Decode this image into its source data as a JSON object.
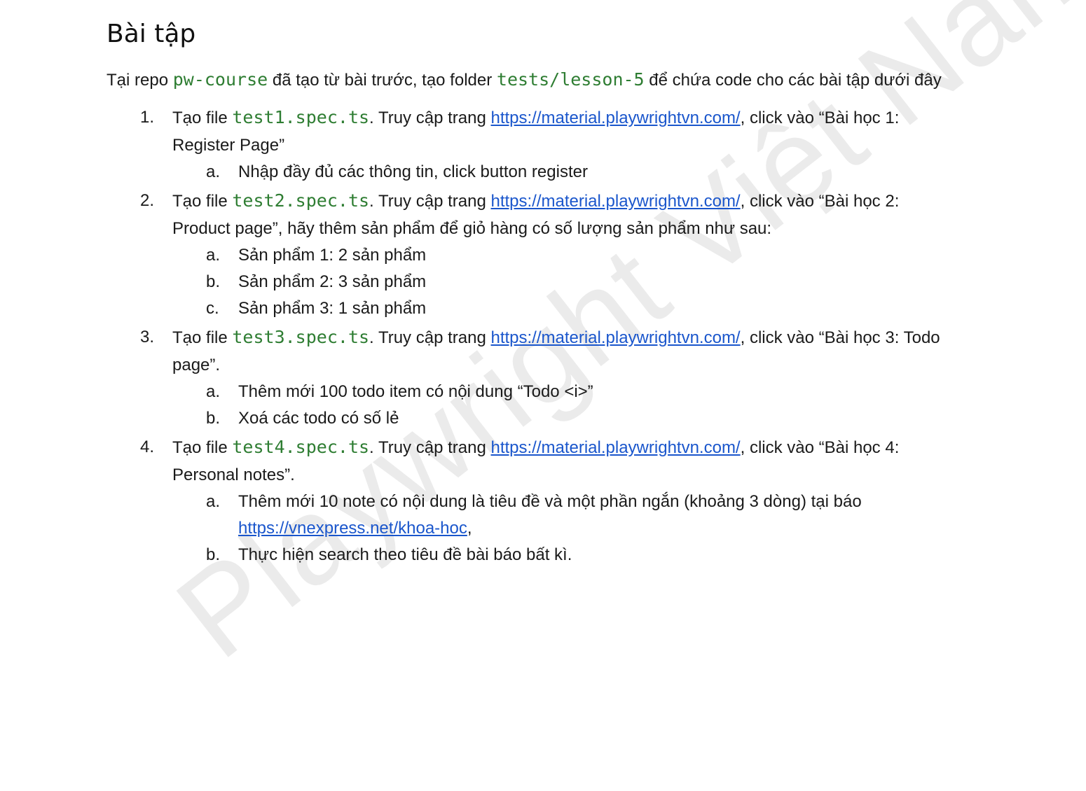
{
  "watermark": "Playwright Việt Nam",
  "title": "Bài tập",
  "intro": {
    "t1": "Tại repo ",
    "code1": "pw-course",
    "t2": " đã tạo từ bài trước, tạo folder ",
    "code2": "tests/lesson-5",
    "t3": " để chứa code cho các bài tập dưới đây"
  },
  "tasks": [
    {
      "num": "1.",
      "pre": "Tạo file ",
      "file": "test1.spec.ts",
      "mid": ". Truy cập trang ",
      "url": "https://material.playwrightvn.com/",
      "post": ", click vào “Bài học 1: Register Page”",
      "subs": [
        {
          "letter": "a.",
          "text": "Nhập đầy đủ các thông tin, click button register"
        }
      ]
    },
    {
      "num": "2.",
      "pre": "Tạo file ",
      "file": "test2.spec.ts",
      "mid": ". Truy cập trang ",
      "url": "https://material.playwrightvn.com/",
      "post": ", click vào “Bài học 2: Product page”, hãy thêm sản phẩm để giỏ hàng có số lượng sản phẩm như sau:",
      "subs": [
        {
          "letter": "a.",
          "text": "Sản phẩm 1: 2 sản phẩm"
        },
        {
          "letter": "b.",
          "text": "Sản phẩm 2: 3 sản phẩm"
        },
        {
          "letter": "c.",
          "text": "Sản phẩm 3: 1 sản phẩm"
        }
      ]
    },
    {
      "num": "3.",
      "pre": "Tạo file ",
      "file": "test3.spec.ts",
      "mid": ". Truy cập trang ",
      "url": "https://material.playwrightvn.com/",
      "post": ", click vào “Bài học 3: Todo page”.",
      "subs": [
        {
          "letter": "a.",
          "text": "Thêm mới 100 todo item có nội dung “Todo <i>”"
        },
        {
          "letter": "b.",
          "text": "Xoá các todo có số lẻ"
        }
      ]
    },
    {
      "num": "4.",
      "pre": "Tạo file ",
      "file": "test4.spec.ts",
      "mid": ". Truy cập trang ",
      "url": "https://material.playwrightvn.com/",
      "post": ", click vào “Bài học 4: Personal notes”.",
      "subs": [
        {
          "letter": "a.",
          "text": "Thêm mới 10 note có nội dung là tiêu đề và một phần ngắn (khoảng 3 dòng) tại báo ",
          "url": "https://vnexpress.net/khoa-hoc",
          "after": ","
        },
        {
          "letter": "b.",
          "text": "Thực hiện search theo tiêu đề bài báo bất kì."
        }
      ]
    }
  ]
}
